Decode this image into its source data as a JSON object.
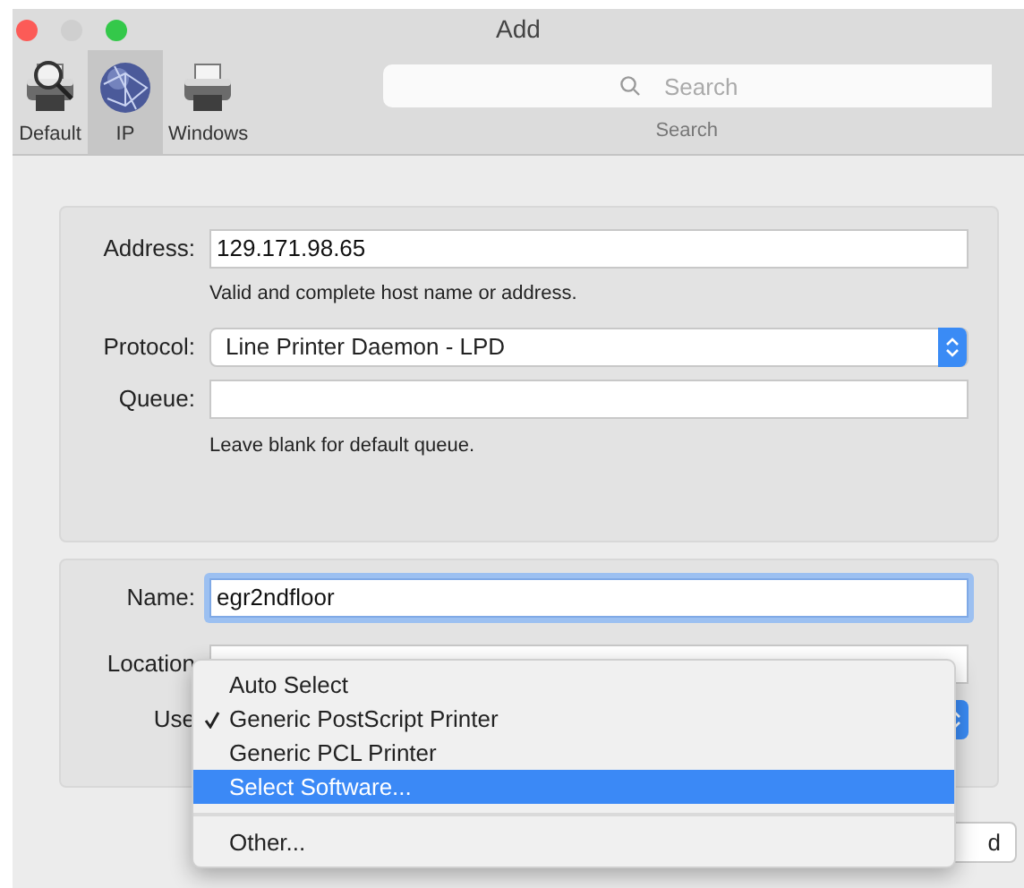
{
  "window": {
    "title": "Add"
  },
  "toolbar": {
    "tabs": [
      {
        "label": "Default",
        "kind": "default",
        "selected": false
      },
      {
        "label": "IP",
        "kind": "ip",
        "selected": true
      },
      {
        "label": "Windows",
        "kind": "windows",
        "selected": false
      }
    ],
    "search": {
      "placeholder": "Search",
      "label": "Search"
    }
  },
  "address_panel": {
    "fields": [
      {
        "label": "Address:",
        "kind": "text",
        "value": "129.171.98.65",
        "hint": "Valid and complete host name or address."
      },
      {
        "label": "Protocol:",
        "kind": "popup",
        "value": "Line Printer Daemon - LPD"
      },
      {
        "label": "Queue:",
        "kind": "text",
        "hint": "Leave blank for default queue."
      }
    ]
  },
  "details_panel": {
    "fields": [
      {
        "label": "Name:",
        "kind": "text",
        "value": "egr2ndfloor",
        "focused": true
      },
      {
        "label": "Location",
        "kind": "text",
        "focused": false
      },
      {
        "label": "Use",
        "kind": "popup"
      }
    ]
  },
  "menu": {
    "items": [
      {
        "kind": "item",
        "label": "Auto Select",
        "checked": false,
        "selected": false
      },
      {
        "kind": "item",
        "label": "Generic PostScript Printer",
        "checked": true,
        "selected": false
      },
      {
        "kind": "item",
        "label": "Generic PCL Printer",
        "checked": false,
        "selected": false
      },
      {
        "kind": "item",
        "label": "Select Software...",
        "checked": false,
        "selected": true
      },
      {
        "kind": "separator"
      },
      {
        "kind": "item",
        "label": "Other...",
        "checked": false,
        "selected": false
      }
    ]
  },
  "add_button": {
    "label": "d"
  }
}
